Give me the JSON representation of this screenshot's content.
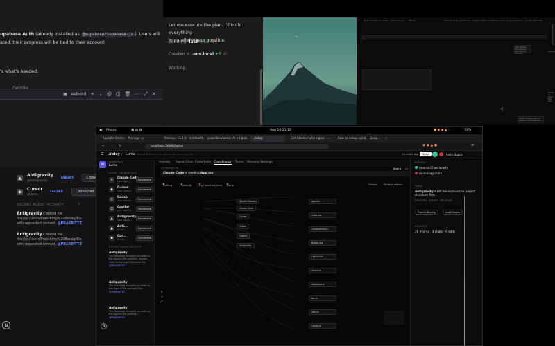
{
  "bg_left": {
    "para_lead": "upabase Auth",
    "para_mid1": " (already installed as ",
    "para_code": "@supabase/supabase-js",
    "para_mid2": "). Users will",
    "para_line2": "ated, their progress will be tied to their account.",
    "needed": "'s what's needed:",
    "cut_text": "Google",
    "editor_label": "esbuild",
    "agents": [
      {
        "name": "Antigravity",
        "sub": "@Antigravity",
        "token": "7AE3R5",
        "status": "Connected"
      },
      {
        "name": "Cursor",
        "sub": "@Kyzo...",
        "token": "7AE3R5",
        "status": "Connected"
      }
    ],
    "recent_label": "RECENT AGENT ACTIVITY",
    "recent_count": "2",
    "activity": [
      {
        "who": "Antigravity",
        "verb": " Created file",
        "path": "file:///c:/Users/Prakshitty%20Bocaly/Do",
        "rest": "with requested content. ",
        "tag": "@PRAKRITTZ"
      },
      {
        "who": "Antigravity",
        "verb": " Created file",
        "path": "file:///c:/Users/Prakshitty%20Bocaly/Do",
        "rest": "with requested content. ",
        "tag": "@PRAKRITTZ"
      }
    ],
    "corner_logo": "N"
  },
  "bg_mid": {
    "line1": "Let me execute the plan. I'll build everything",
    "line2": "in parallel where possible.",
    "edited_label": "Edited",
    "edited_item": "Task",
    "edited_add": "+10",
    "edited_del": "-0",
    "created_label": "Created",
    "created_item": ".env.local",
    "created_add": "+5",
    "created_del": "-0",
    "working": "Working."
  },
  "bg_right": {
    "tabs": [
      "Rank of supabase-email - Vercel Sound",
      "Github",
      "How to create git on tree - Google Search",
      "undefined_error: at any platform.. | create with new"
    ],
    "bubble1": "Hard Headed Drag Spacing from Manual Forumon",
    "bubble2": "Create a design spec of spices for the dispatched...",
    "side_text1": "analyzed",
    "side_text2": "Create an agent that logs"
  },
  "browser": {
    "topbar": {
      "places": "Places",
      "date": "Aug 20  21:12",
      "battery": "73%"
    },
    "tabs": [
      "Update Center - Manage yo",
      "Release v1.3.0 - siddharth...",
      "prakritisv/Luma: AI ed plat...",
      "./relay",
      "Get Started with ngrok - ...",
      "how to setup ngrok - Goog..."
    ],
    "url": "localhost:3000/luma",
    "header": {
      "app": "./relay",
      "project": "Luma",
      "desc": "Shared AI context for your team and machines"
    },
    "header_right": {
      "sync": "Synced 5 ago",
      "sync_btn": "Sync",
      "user": "Ansh Gupta"
    },
    "workspace": {
      "label": "WORKSPACE",
      "name": "Luma"
    },
    "agent_section": "AGENT CREDENTIALS",
    "agents": [
      {
        "name": "Claude Code",
        "sub": "your agent...",
        "status": "Connected"
      },
      {
        "name": "Cursor",
        "sub": "your agent...",
        "status": "Connected"
      },
      {
        "name": "Codex",
        "sub": "your agent...",
        "status": "Connected"
      },
      {
        "name": "Copilot",
        "sub": "your agent...",
        "status": "Connected"
      },
      {
        "name": "Antigravity",
        "sub": "your agent...",
        "status": "Connected"
      },
      {
        "name": "Anti...",
        "sub": "Build...",
        "status": "Connected"
      },
      {
        "name": "Cur...",
        "sub": "Build...",
        "status": "Connected"
      }
    ],
    "recent_section": "RECENT AGENT ACTIVITY",
    "activity": [
      {
        "who": "Antigravity",
        "text": "The following changes w made by the Agent (file content), please refer to the user/Preethilai flie.",
        "tag": "@PRAKRITTZ"
      },
      {
        "who": "Antigravity",
        "text": "The following changes w made by the Agent (file content) File...",
        "tag": "@PRAKRITTZ"
      },
      {
        "who": "Antigravity",
        "text": "The following changes w made by the Agent (file content)...",
        "tag": "@PRAKRITTZ"
      }
    ],
    "nav_tabs": [
      "Activity",
      "Agent Chat",
      "Code Edits",
      "Coordinator",
      "Team",
      "Memory",
      "Settings"
    ],
    "selected_tab": "Coordinator",
    "board_label": "COORDINATOR",
    "board_tabs": [
      "Board",
      "List"
    ],
    "status_prefix": "Claude Code",
    "status_mid": " is reading ",
    "status_file": "App.tsx",
    "legend": [
      "Editing",
      "Reading",
      "Any working here",
      "Done"
    ],
    "legend_right": [
      "Flatten",
      "Recent editors"
    ],
    "nodes": {
      "root": "@prakritibocaly",
      "center": [
        "Claude Code",
        "Cursor",
        "Codex",
        "Copilot",
        "Antigravity"
      ],
      "files": [
        "App.tsx",
        "index.tsx",
        "components/ui",
        "Button.tsx",
        "Layout.tsx",
        "hooks.ts",
        "database.ts",
        "api.ts",
        "utils.ts",
        "config.ts"
      ]
    },
    "right_panel": {
      "people_label": "PEOPLE",
      "people": [
        "Ananta Chakravarty",
        "Anukhya@2005"
      ],
      "task_label": "TASK",
      "task_who": "Antigravity",
      "task_text": " • Let me explore the project structure first.",
      "task_sub": "Scan the project structure",
      "chips": [
        "Prakriti Bocaly",
        "Ansh Gupta"
      ],
      "stats_label": "RESULTS",
      "stats": "26 events · 3 chats · 9 edits"
    },
    "zoom_controls": [
      "+",
      "−",
      "⤢"
    ]
  }
}
